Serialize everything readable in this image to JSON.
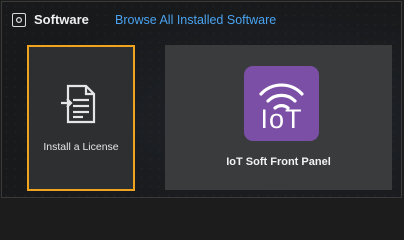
{
  "header": {
    "title": "Software",
    "browse_link": "Browse All Installed Software"
  },
  "tiles": [
    {
      "label": "Install a License",
      "icon": "license-file-icon",
      "selected": true
    },
    {
      "label": "IoT Soft Front Panel",
      "icon": "iot-app-icon",
      "icon_text": "IoT"
    }
  ],
  "colors": {
    "selection": "#f0a31e",
    "link": "#4aa3f0",
    "iot_icon_bg": "#7b4fa6"
  }
}
